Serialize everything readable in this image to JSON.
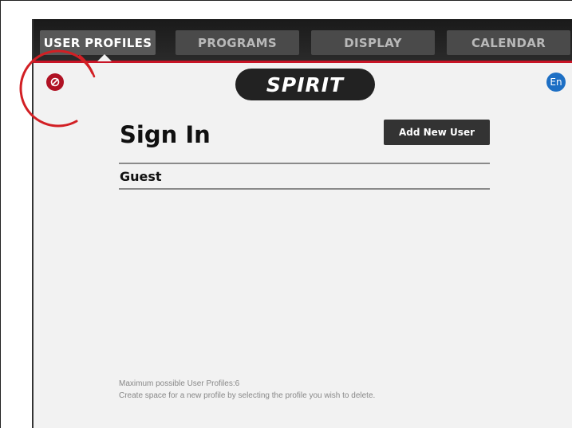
{
  "tabs": [
    {
      "label": "USER PROFILES",
      "active": true
    },
    {
      "label": "PROGRAMS",
      "active": false
    },
    {
      "label": "DISPLAY",
      "active": false
    },
    {
      "label": "CALENDAR",
      "active": false
    }
  ],
  "logo": {
    "text": "SPIRIT"
  },
  "language": {
    "label": "En"
  },
  "signin": {
    "title": "Sign In",
    "add_button": "Add New User"
  },
  "profiles": [
    {
      "name": "Guest"
    }
  ],
  "footer": {
    "max_profiles": "Maximum possible User Profiles:6",
    "hint": "Create space for a new profile by selecting the profile you wish to delete."
  },
  "icons": {
    "close": "close-circle-icon",
    "language": "language-globe-icon"
  },
  "colors": {
    "accent_red": "#c81426",
    "topbar": "#1f1f1f",
    "lang_blue": "#1d6fc4",
    "button_dark": "#333333"
  }
}
